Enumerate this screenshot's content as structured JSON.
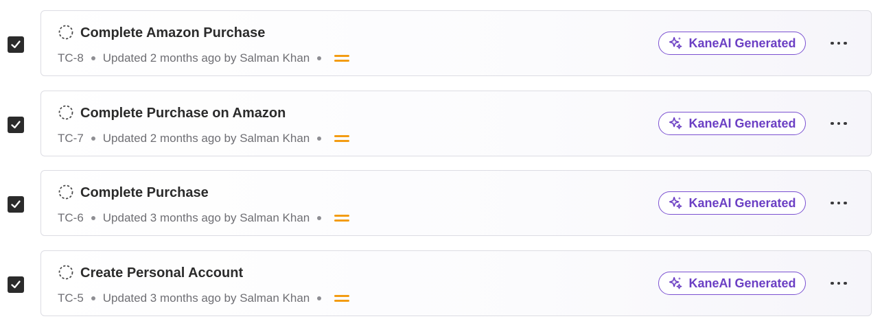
{
  "colors": {
    "checkbox": "#2b2b2b",
    "badge_accent": "#6b3fc4",
    "priority_medium": "#f39c12",
    "meta_text": "#6e6e73"
  },
  "test_cases": [
    {
      "checked": true,
      "status_icon": "dashed-circle-icon",
      "title": "Complete Amazon Purchase",
      "id": "TC-8",
      "updated": "Updated 2 months ago by Salman Khan",
      "priority_icon": "equals-priority-icon",
      "badge": "KaneAI Generated"
    },
    {
      "checked": true,
      "status_icon": "dashed-circle-icon",
      "title": "Complete Purchase on Amazon",
      "id": "TC-7",
      "updated": "Updated 2 months ago by Salman Khan",
      "priority_icon": "equals-priority-icon",
      "badge": "KaneAI Generated"
    },
    {
      "checked": true,
      "status_icon": "dashed-circle-icon",
      "title": "Complete Purchase",
      "id": "TC-6",
      "updated": "Updated 3 months ago by Salman Khan",
      "priority_icon": "equals-priority-icon",
      "badge": "KaneAI Generated"
    },
    {
      "checked": true,
      "status_icon": "dashed-circle-icon",
      "title": "Create Personal Account",
      "id": "TC-5",
      "updated": "Updated 3 months ago by Salman Khan",
      "priority_icon": "equals-priority-icon",
      "badge": "KaneAI Generated"
    }
  ]
}
